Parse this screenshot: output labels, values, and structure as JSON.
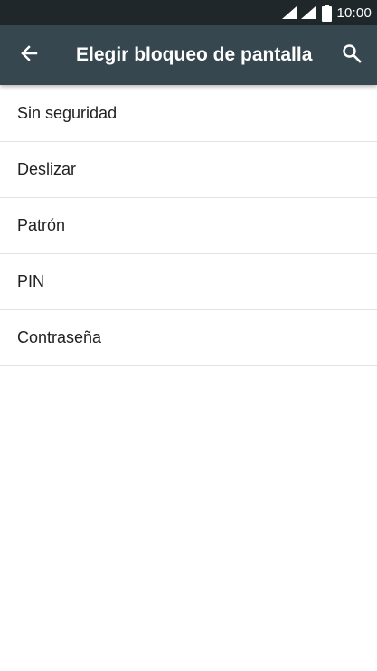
{
  "status_bar": {
    "time": "10:00",
    "icons": [
      "wifi-icon",
      "signal-icon",
      "battery-icon"
    ]
  },
  "toolbar": {
    "title": "Elegir bloqueo de pantalla",
    "back_icon": "arrow-back-icon",
    "search_icon": "search-icon"
  },
  "options": [
    {
      "label": "Sin seguridad"
    },
    {
      "label": "Deslizar"
    },
    {
      "label": "Patrón"
    },
    {
      "label": "PIN"
    },
    {
      "label": "Contraseña"
    }
  ],
  "colors": {
    "status_bar": "#1f272b",
    "toolbar": "#37474f",
    "background": "#ffffff",
    "divider": "#e3e3e3",
    "text": "#212121"
  }
}
